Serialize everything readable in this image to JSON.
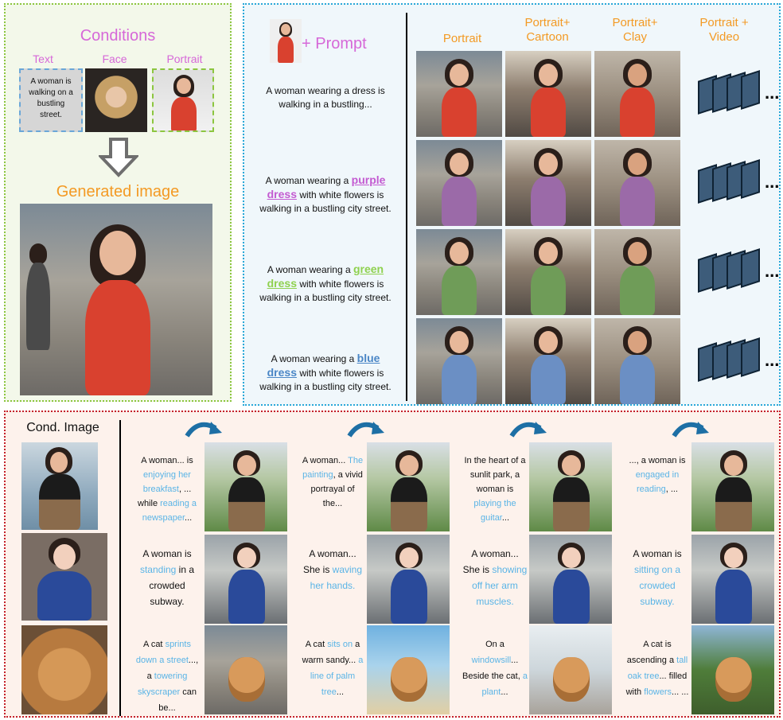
{
  "panel1": {
    "title": "Conditions",
    "labels": [
      "Text",
      "Face",
      "Portrait"
    ],
    "text_condition": "A woman is walking on a bustling street.",
    "output_label": "Generated image"
  },
  "panel2": {
    "prompt_header": "+ Prompt",
    "column_headers": [
      "Portrait",
      "Portrait+\nCartoon",
      "Portrait+\nClay",
      "Portrait +\nVideo"
    ],
    "ellipsis": "...",
    "prompts": [
      {
        "pre": "A woman wearing a dress is walking in a bustling...",
        "color_word": "",
        "color_word2": "",
        "post": "",
        "color": ""
      },
      {
        "pre": "A woman wearing a ",
        "color_word": "purple",
        "color_word2": "dress",
        "post": " with white flowers is walking in a bustling city street.",
        "color": "#c35ad1"
      },
      {
        "pre": "A woman wearing a ",
        "color_word": "green",
        "color_word2": "dress",
        "post": " with white flowers is walking in a bustling city street.",
        "color": "#8fd14f"
      },
      {
        "pre": "A woman wearing a ",
        "color_word": "blue",
        "color_word2": "dress",
        "post": " with white flowers is walking in a bustling city street.",
        "color": "#4a86c6"
      }
    ],
    "dress_colors": [
      "#d9412f",
      "#9b6aa8",
      "#6f9c58",
      "#6b8fc4"
    ]
  },
  "panel3": {
    "cond_label": "Cond. Image",
    "rows": [
      [
        [
          {
            "t": "A woman... is ",
            "b": false
          },
          {
            "t": "enjoying her breakfast",
            "b": true
          },
          {
            "t": ", ... while ",
            "b": false
          },
          {
            "t": "reading a newspaper",
            "b": true
          },
          {
            "t": "...",
            "b": false
          }
        ],
        [
          {
            "t": "A woman... ",
            "b": false
          },
          {
            "t": "The painting",
            "b": true
          },
          {
            "t": ", a vivid portrayal of the...",
            "b": false
          }
        ],
        [
          {
            "t": "In the heart of a sunlit park, a woman is ",
            "b": false
          },
          {
            "t": "playing the guitar",
            "b": true
          },
          {
            "t": "...",
            "b": false
          }
        ],
        [
          {
            "t": "..., a woman is ",
            "b": false
          },
          {
            "t": "engaged in reading",
            "b": true
          },
          {
            "t": ", ...",
            "b": false
          }
        ]
      ],
      [
        [
          {
            "t": "A woman is ",
            "b": false
          },
          {
            "t": "standing",
            "b": true
          },
          {
            "t": " in a crowded subway.",
            "b": false
          }
        ],
        [
          {
            "t": "A woman... She is ",
            "b": false
          },
          {
            "t": "waving her hands.",
            "b": true
          }
        ],
        [
          {
            "t": "A woman... She is ",
            "b": false
          },
          {
            "t": "showing off her arm muscles.",
            "b": true
          }
        ],
        [
          {
            "t": "A woman is ",
            "b": false
          },
          {
            "t": "sitting on a crowded subway.",
            "b": true
          }
        ]
      ],
      [
        [
          {
            "t": "A cat ",
            "b": false
          },
          {
            "t": "sprints down a street",
            "b": true
          },
          {
            "t": "..., a ",
            "b": false
          },
          {
            "t": "towering skyscraper",
            "b": true
          },
          {
            "t": " can be...",
            "b": false
          }
        ],
        [
          {
            "t": "A cat ",
            "b": false
          },
          {
            "t": "sits on",
            "b": true
          },
          {
            "t": " a warm sandy... ",
            "b": false
          },
          {
            "t": "a line of palm tree",
            "b": true
          },
          {
            "t": "...",
            "b": false
          }
        ],
        [
          {
            "t": "On a ",
            "b": false
          },
          {
            "t": "windowsill",
            "b": true
          },
          {
            "t": "... Beside the cat, ",
            "b": false
          },
          {
            "t": "a plant",
            "b": true
          },
          {
            "t": "...",
            "b": false
          }
        ],
        [
          {
            "t": "A cat is ascending a ",
            "b": false
          },
          {
            "t": "tall oak tree",
            "b": true
          },
          {
            "t": "... filled with ",
            "b": false
          },
          {
            "t": "flowers",
            "b": true
          },
          {
            "t": "... ...",
            "b": false
          }
        ]
      ]
    ]
  }
}
